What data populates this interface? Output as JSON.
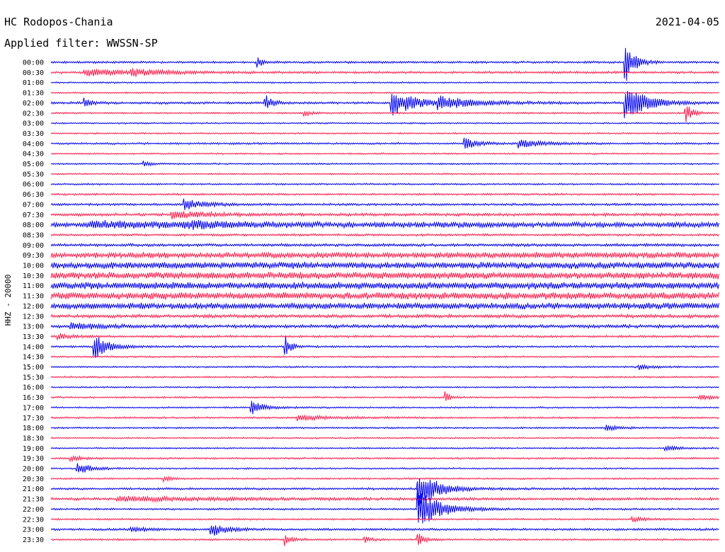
{
  "header": {
    "station": "HC Rodopos-Chania",
    "date": "2021-04-05",
    "filter": "Applied filter: WWSSN-SP"
  },
  "chart_data": {
    "type": "line",
    "ylabel": "HHZ - 20000",
    "colors": {
      "odd": "#0000ee",
      "even": "#ff1a4a"
    },
    "rows": [
      {
        "label": "00:00",
        "noise": 0.28,
        "events": [
          {
            "t": 0.31,
            "amp": 1.0,
            "dur": 0.01
          },
          {
            "t": 0.86,
            "amp": 5.0,
            "dur": 0.012
          }
        ]
      },
      {
        "label": "00:30",
        "noise": 0.3,
        "events": [
          {
            "t": 0.05,
            "amp": 0.8,
            "dur": 0.06
          },
          {
            "t": 0.12,
            "amp": 0.7,
            "dur": 0.05
          }
        ]
      },
      {
        "label": "01:00",
        "noise": 0.2,
        "events": []
      },
      {
        "label": "01:30",
        "noise": 0.2,
        "events": []
      },
      {
        "label": "02:00",
        "noise": 0.3,
        "events": [
          {
            "t": 0.05,
            "amp": 1.2,
            "dur": 0.01
          },
          {
            "t": 0.32,
            "amp": 2.0,
            "dur": 0.01
          },
          {
            "t": 0.51,
            "amp": 3.0,
            "dur": 0.035
          },
          {
            "t": 0.58,
            "amp": 1.2,
            "dur": 0.06
          },
          {
            "t": 0.86,
            "amp": 4.2,
            "dur": 0.03
          }
        ]
      },
      {
        "label": "02:30",
        "noise": 0.22,
        "events": [
          {
            "t": 0.38,
            "amp": 0.6,
            "dur": 0.01
          },
          {
            "t": 0.95,
            "amp": 2.2,
            "dur": 0.01
          }
        ]
      },
      {
        "label": "03:00",
        "noise": 0.2,
        "events": []
      },
      {
        "label": "03:30",
        "noise": 0.2,
        "events": []
      },
      {
        "label": "04:00",
        "noise": 0.25,
        "events": [
          {
            "t": 0.62,
            "amp": 1.2,
            "dur": 0.02
          },
          {
            "t": 0.7,
            "amp": 0.9,
            "dur": 0.04
          }
        ]
      },
      {
        "label": "04:30",
        "noise": 0.2,
        "events": []
      },
      {
        "label": "05:00",
        "noise": 0.22,
        "events": [
          {
            "t": 0.14,
            "amp": 0.6,
            "dur": 0.01
          }
        ]
      },
      {
        "label": "05:30",
        "noise": 0.2,
        "events": []
      },
      {
        "label": "06:00",
        "noise": 0.22,
        "events": []
      },
      {
        "label": "06:30",
        "noise": 0.26,
        "events": []
      },
      {
        "label": "07:00",
        "noise": 0.3,
        "events": [
          {
            "t": 0.2,
            "amp": 1.2,
            "dur": 0.03
          }
        ]
      },
      {
        "label": "07:30",
        "noise": 0.38,
        "events": [
          {
            "t": 0.18,
            "amp": 0.8,
            "dur": 0.05
          }
        ]
      },
      {
        "label": "08:00",
        "noise": 0.7,
        "events": [
          {
            "t": 0.06,
            "amp": 0.5,
            "dur": 0.15
          },
          {
            "t": 0.2,
            "amp": 0.6,
            "dur": 0.05
          }
        ]
      },
      {
        "label": "08:30",
        "noise": 0.3,
        "events": []
      },
      {
        "label": "09:00",
        "noise": 0.38,
        "events": []
      },
      {
        "label": "09:30",
        "noise": 0.75,
        "events": []
      },
      {
        "label": "10:00",
        "noise": 0.85,
        "events": []
      },
      {
        "label": "10:30",
        "noise": 0.9,
        "events": []
      },
      {
        "label": "11:00",
        "noise": 0.9,
        "events": []
      },
      {
        "label": "11:30",
        "noise": 0.9,
        "events": []
      },
      {
        "label": "12:00",
        "noise": 0.8,
        "events": []
      },
      {
        "label": "12:30",
        "noise": 0.45,
        "events": []
      },
      {
        "label": "13:00",
        "noise": 0.45,
        "events": [
          {
            "t": 0.03,
            "amp": 0.8,
            "dur": 0.03
          }
        ]
      },
      {
        "label": "13:30",
        "noise": 0.3,
        "events": [
          {
            "t": 0.01,
            "amp": 0.6,
            "dur": 0.02
          }
        ]
      },
      {
        "label": "14:00",
        "noise": 0.25,
        "events": [
          {
            "t": 0.065,
            "amp": 3.0,
            "dur": 0.02
          },
          {
            "t": 0.35,
            "amp": 3.0,
            "dur": 0.008
          }
        ]
      },
      {
        "label": "14:30",
        "noise": 0.22,
        "events": []
      },
      {
        "label": "15:00",
        "noise": 0.22,
        "events": [
          {
            "t": 0.88,
            "amp": 0.6,
            "dur": 0.02
          }
        ]
      },
      {
        "label": "15:30",
        "noise": 0.22,
        "events": []
      },
      {
        "label": "16:00",
        "noise": 0.2,
        "events": []
      },
      {
        "label": "16:30",
        "noise": 0.22,
        "events": [
          {
            "t": 0.59,
            "amp": 1.6,
            "dur": 0.006
          },
          {
            "t": 0.97,
            "amp": 0.6,
            "dur": 0.02
          }
        ]
      },
      {
        "label": "17:00",
        "noise": 0.2,
        "events": [
          {
            "t": 0.3,
            "amp": 1.6,
            "dur": 0.02
          }
        ]
      },
      {
        "label": "17:30",
        "noise": 0.24,
        "events": [
          {
            "t": 0.37,
            "amp": 0.6,
            "dur": 0.05
          }
        ]
      },
      {
        "label": "18:00",
        "noise": 0.22,
        "events": [
          {
            "t": 0.83,
            "amp": 0.6,
            "dur": 0.02
          }
        ]
      },
      {
        "label": "18:30",
        "noise": 0.2,
        "events": []
      },
      {
        "label": "19:00",
        "noise": 0.2,
        "events": [
          {
            "t": 0.92,
            "amp": 0.5,
            "dur": 0.02
          }
        ]
      },
      {
        "label": "19:30",
        "noise": 0.24,
        "events": [
          {
            "t": 0.03,
            "amp": 0.5,
            "dur": 0.02
          }
        ]
      },
      {
        "label": "20:00",
        "noise": 0.2,
        "events": [
          {
            "t": 0.04,
            "amp": 1.4,
            "dur": 0.02
          }
        ]
      },
      {
        "label": "20:30",
        "noise": 0.22,
        "events": [
          {
            "t": 0.17,
            "amp": 0.6,
            "dur": 0.01
          }
        ]
      },
      {
        "label": "21:00",
        "noise": 0.28,
        "events": [
          {
            "t": 0.55,
            "amp": 4.0,
            "dur": 0.03
          }
        ]
      },
      {
        "label": "21:30",
        "noise": 0.35,
        "events": [
          {
            "t": 0.1,
            "amp": 0.5,
            "dur": 0.15
          }
        ]
      },
      {
        "label": "22:00",
        "noise": 0.25,
        "events": [
          {
            "t": 0.55,
            "amp": 5.0,
            "dur": 0.03
          }
        ]
      },
      {
        "label": "22:30",
        "noise": 0.22,
        "events": [
          {
            "t": 0.87,
            "amp": 0.6,
            "dur": 0.02
          }
        ]
      },
      {
        "label": "23:00",
        "noise": 0.3,
        "events": [
          {
            "t": 0.24,
            "amp": 1.6,
            "dur": 0.02
          },
          {
            "t": 0.12,
            "amp": 0.6,
            "dur": 0.02
          }
        ]
      },
      {
        "label": "23:30",
        "noise": 0.25,
        "events": [
          {
            "t": 0.35,
            "amp": 1.3,
            "dur": 0.01
          },
          {
            "t": 0.55,
            "amp": 1.4,
            "dur": 0.01
          },
          {
            "t": 0.47,
            "amp": 0.6,
            "dur": 0.01
          }
        ]
      }
    ]
  }
}
